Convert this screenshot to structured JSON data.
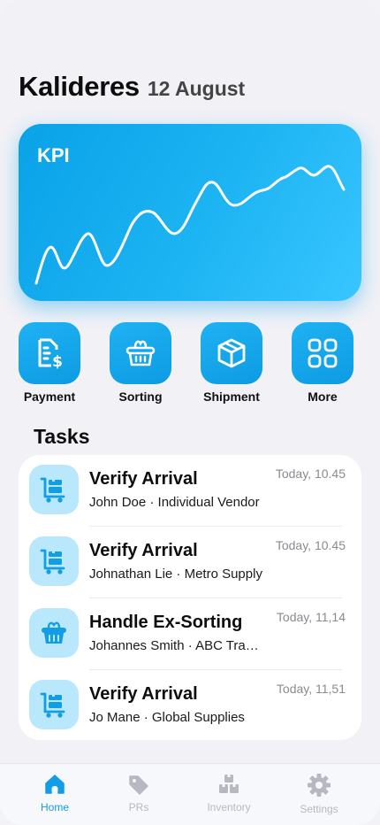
{
  "header": {
    "location": "Kalideres",
    "date": "12 August"
  },
  "kpi": {
    "title": "KPI"
  },
  "actions": [
    {
      "label": "Payment",
      "icon": "invoice-dollar-icon"
    },
    {
      "label": "Sorting",
      "icon": "basket-icon"
    },
    {
      "label": "Shipment",
      "icon": "box-icon"
    },
    {
      "label": "More",
      "icon": "grid-icon"
    }
  ],
  "tasks": {
    "title": "Tasks",
    "items": [
      {
        "title": "Verify Arrival",
        "subtitle": "John Doe · Individual Vendor",
        "time": "Today, 10.45",
        "icon": "cart-icon"
      },
      {
        "title": "Verify Arrival",
        "subtitle": "Johnathan Lie · Metro Supply",
        "time": "Today, 10.45",
        "icon": "cart-icon"
      },
      {
        "title": "Handle Ex-Sorting",
        "subtitle": "Johannes Smith · ABC Trading",
        "time": "Today, 11,14",
        "icon": "basket-icon"
      },
      {
        "title": "Verify Arrival",
        "subtitle": "Jo Mane · Global Supplies",
        "time": "Today, 11,51",
        "icon": "cart-icon"
      }
    ]
  },
  "tabbar": {
    "items": [
      {
        "label": "Home",
        "icon": "home-icon",
        "active": true
      },
      {
        "label": "PRs",
        "icon": "tag-icon",
        "active": false
      },
      {
        "label": "Inventory",
        "icon": "boxes-icon",
        "active": false
      },
      {
        "label": "Settings",
        "icon": "gear-icon",
        "active": false
      }
    ]
  },
  "colors": {
    "accent": "#129ee4",
    "accent_light": "#b9e7fb",
    "inactive": "#b8b8c2"
  }
}
